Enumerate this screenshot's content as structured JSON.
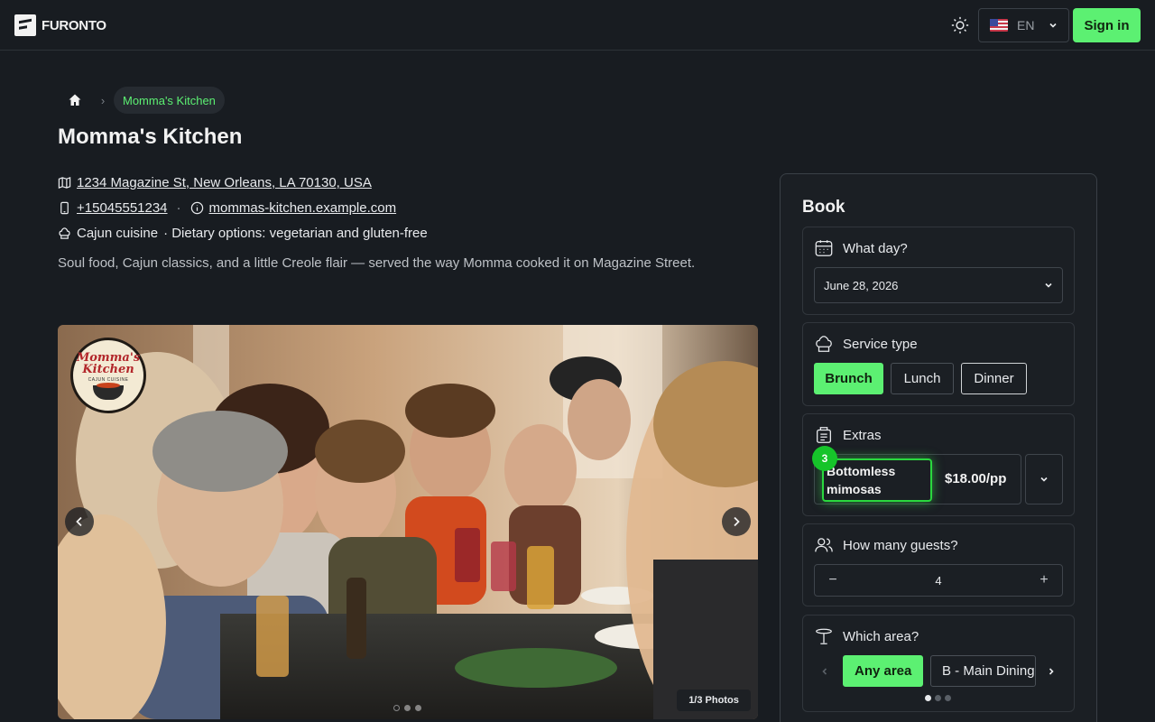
{
  "header": {
    "brand": "FURONTO",
    "language": "EN",
    "signin_label": "Sign in"
  },
  "breadcrumb": {
    "current": "Momma's Kitchen"
  },
  "restaurant": {
    "name": "Momma's Kitchen",
    "address": "1234 Magazine St, New Orleans, LA 70130, USA",
    "phone": "+15045551234",
    "separator": "·",
    "website": "mommas-kitchen.example.com",
    "cuisine": "Cajun cuisine",
    "dietary": "· Dietary options: vegetarian and gluten-free",
    "description": "Soul food, Cajun classics, and a little Creole flair — served the way Momma cooked it on Magazine Street."
  },
  "gallery": {
    "logo_line1": "Momma's",
    "logo_line2": "Kitchen",
    "logo_tagline": "CAJUN CUISINE",
    "counter": "1/3 Photos",
    "total": 3,
    "current_index": 0
  },
  "booking": {
    "title": "Book",
    "day": {
      "label": "What day?",
      "value": "June 28, 2026"
    },
    "service": {
      "label": "Service type",
      "options": [
        "Brunch",
        "Lunch",
        "Dinner"
      ],
      "selected": "Brunch"
    },
    "extras": {
      "label": "Extras",
      "item_name": "Bottomless mimosas",
      "item_price": "$18.00/pp",
      "badge_count": "3"
    },
    "guests": {
      "label": "How many guests?",
      "value": "4",
      "minus": "−",
      "plus": "+"
    },
    "area": {
      "label": "Which area?",
      "options": [
        "Any area",
        "B - Main Dining"
      ],
      "selected": "Any area"
    }
  },
  "colors": {
    "accent": "#5cf072",
    "background": "#181c21"
  }
}
